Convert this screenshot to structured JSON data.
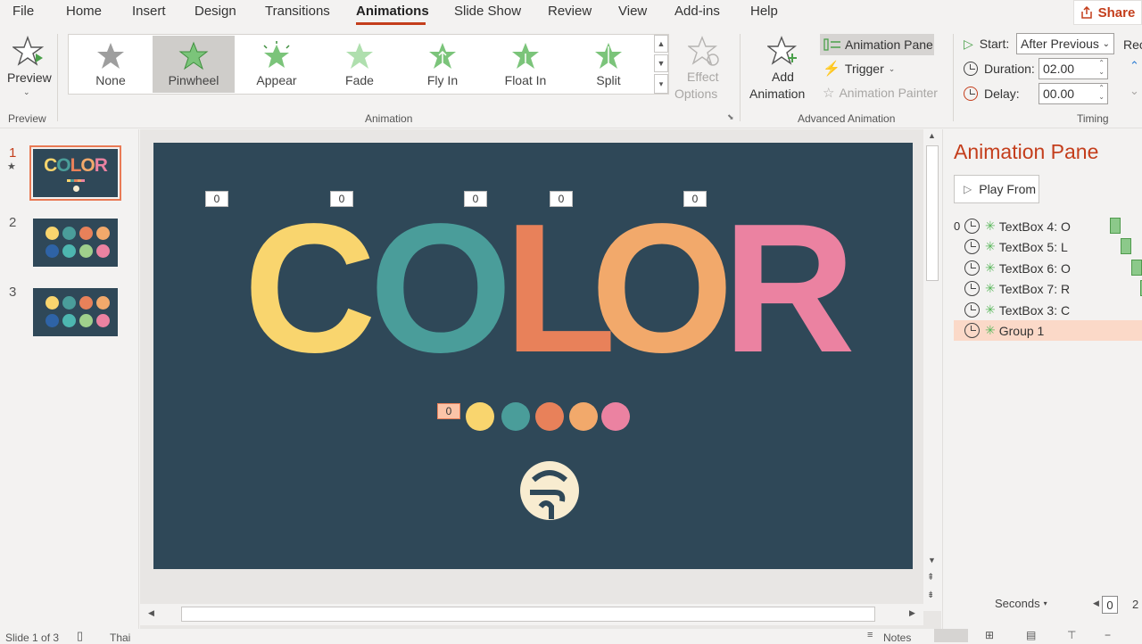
{
  "menu": {
    "items": [
      "File",
      "Home",
      "Insert",
      "Design",
      "Transitions",
      "Animations",
      "Slide Show",
      "Review",
      "View",
      "Add-ins",
      "Help"
    ],
    "active": "Animations",
    "share_label": "Share"
  },
  "ribbon": {
    "preview": {
      "button_label": "Preview",
      "group_label": "Preview"
    },
    "animation_gallery": {
      "items": [
        "None",
        "Pinwheel",
        "Appear",
        "Fade",
        "Fly In",
        "Float In",
        "Split"
      ],
      "selected": "Pinwheel",
      "effect_options_label_1": "Effect",
      "effect_options_label_2": "Options",
      "group_label": "Animation"
    },
    "advanced": {
      "add_animation_1": "Add",
      "add_animation_2": "Animation",
      "animation_pane": "Animation Pane",
      "trigger": "Trigger",
      "animation_painter": "Animation Painter",
      "group_label": "Advanced Animation"
    },
    "timing": {
      "start_label": "Start:",
      "start_value": "After Previous",
      "duration_label": "Duration:",
      "duration_value": "02.00",
      "delay_label": "Delay:",
      "delay_value": "00.00",
      "reorder_label": "Rec",
      "group_label": "Timing"
    }
  },
  "thumbnails": {
    "numbers": [
      "1",
      "2",
      "3"
    ],
    "slide1_title": "COLOR"
  },
  "slide": {
    "letters": [
      "C",
      "O",
      "L",
      "O",
      "R"
    ],
    "letter_colors": [
      "#f9d56e",
      "#4a9d9a",
      "#e8815a",
      "#f2a96b",
      "#eb82a1"
    ],
    "tags": [
      "0",
      "0",
      "0",
      "0",
      "0"
    ],
    "dots_tag": "0",
    "dot_colors": [
      "#f9d56e",
      "#4a9d9a",
      "#e8815a",
      "#f2a96b",
      "#eb82a1"
    ],
    "background": "#2f4858",
    "logo_color": "#f8ecd0"
  },
  "animation_pane": {
    "title": "Animation Pane",
    "play_from": "Play From",
    "first_number": "0",
    "items": [
      "TextBox 4: O",
      "TextBox 5: L",
      "TextBox 6: O",
      "TextBox 7: R",
      "TextBox 3: C",
      "Group 1"
    ],
    "selected_index": 5,
    "seconds_label": "Seconds",
    "timeline_start": "0",
    "timeline_next": "2"
  },
  "status": {
    "slide_of": "Slide 1 of 3",
    "language": "Thai",
    "notes": "Notes"
  },
  "colors": {
    "accent": "#c43e1c",
    "selected_row": "#fbd9c8",
    "star_green": "#5bb85c"
  }
}
